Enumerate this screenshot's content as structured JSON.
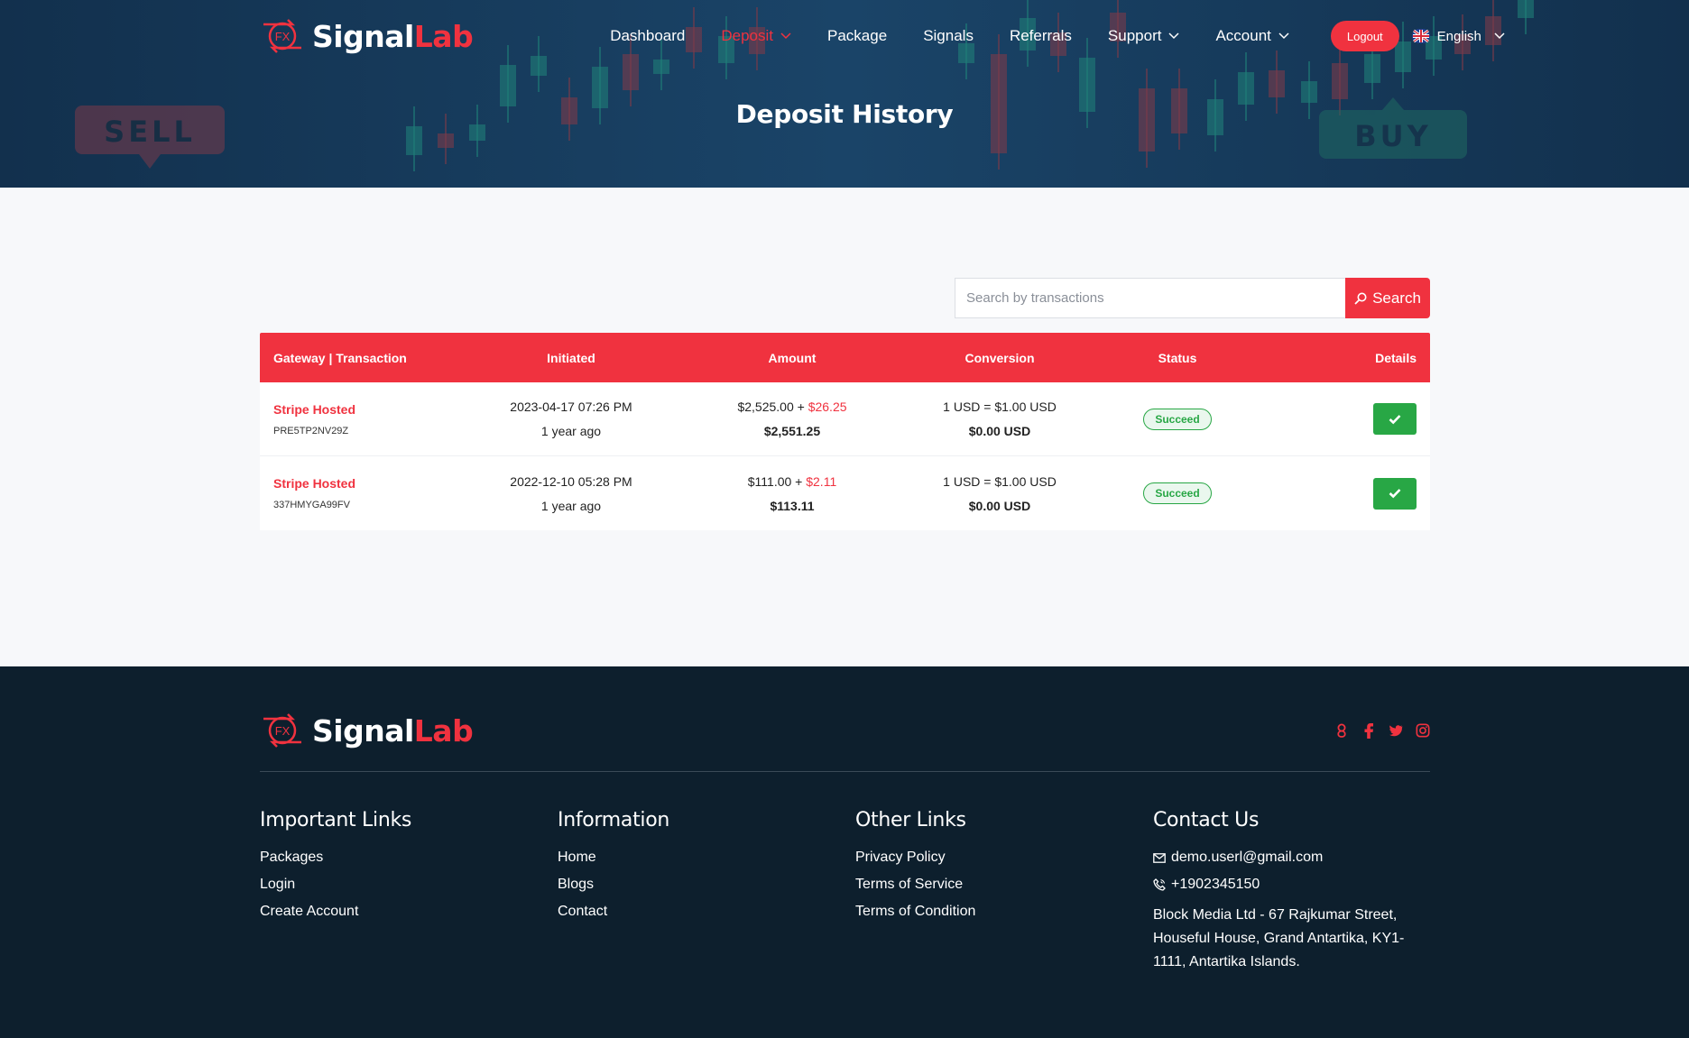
{
  "brand": {
    "logo_mark": "FX",
    "name_part1": "Signal",
    "name_part2": "Lab"
  },
  "nav": {
    "items": [
      {
        "label": "Dashboard",
        "active": false,
        "dropdown": false
      },
      {
        "label": "Deposit",
        "active": true,
        "dropdown": true
      },
      {
        "label": "Package",
        "active": false,
        "dropdown": false
      },
      {
        "label": "Signals",
        "active": false,
        "dropdown": false
      },
      {
        "label": "Referrals",
        "active": false,
        "dropdown": false
      },
      {
        "label": "Support",
        "active": false,
        "dropdown": true
      },
      {
        "label": "Account",
        "active": false,
        "dropdown": true
      }
    ],
    "logout_label": "Logout",
    "language": "English"
  },
  "hero": {
    "title": "Deposit History",
    "sell_label": "SELL",
    "buy_label": "BUY"
  },
  "search": {
    "placeholder": "Search by transactions",
    "button_label": "Search"
  },
  "table": {
    "headers": [
      "Gateway | Transaction",
      "Initiated",
      "Amount",
      "Conversion",
      "Status",
      "Details"
    ],
    "rows": [
      {
        "gateway": "Stripe Hosted",
        "trx": "PRE5TP2NV29Z",
        "date": "2023-04-17 07:26 PM",
        "ago": "1 year ago",
        "amount": "$2,525.00 + ",
        "charge": "$26.25",
        "total": "$2,551.25",
        "rate": "1 USD = $1.00 USD",
        "conversion": "$0.00 USD",
        "status": "Succeed"
      },
      {
        "gateway": "Stripe Hosted",
        "trx": "337HMYGA99FV",
        "date": "2022-12-10 05:28 PM",
        "ago": "1 year ago",
        "amount": "$111.00 + ",
        "charge": "$2.11",
        "total": "$113.11",
        "rate": "1 USD = $1.00 USD",
        "conversion": "$0.00 USD",
        "status": "Succeed"
      }
    ]
  },
  "footer": {
    "important": {
      "title": "Important Links",
      "links": [
        "Packages",
        "Login",
        "Create Account"
      ]
    },
    "information": {
      "title": "Information",
      "links": [
        "Home",
        "Blogs",
        "Contact"
      ]
    },
    "other": {
      "title": "Other Links",
      "links": [
        "Privacy Policy",
        "Terms of Service",
        "Terms of Condition"
      ]
    },
    "contact": {
      "title": "Contact Us",
      "email": "demo.userl@gmail.com",
      "phone": "+1902345150",
      "address": "Block Media Ltd - 67 Rajkumar Street, Houseful House, Grand Antartika, KY1-1111, Antartika Islands."
    },
    "socials": [
      "google-icon",
      "facebook-icon",
      "twitter-icon",
      "instagram-icon"
    ]
  },
  "colors": {
    "accent": "#f0323f",
    "hero_bg": "#153a5a",
    "footer_bg": "#0d1f2d",
    "success": "#28a745"
  }
}
